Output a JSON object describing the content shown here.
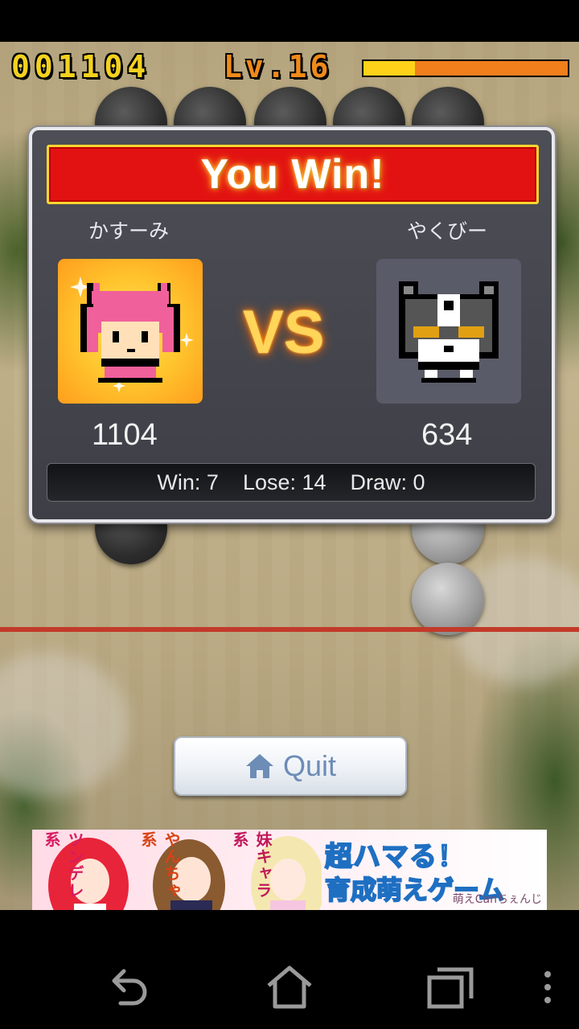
{
  "hud": {
    "score": "001104",
    "level": "Lv.16",
    "level_progress": 0.25,
    "colors": {
      "score": "#f3d21e",
      "level": "#f08a1a"
    }
  },
  "result": {
    "banner": "You Win!",
    "vs": "VS",
    "player": {
      "name": "かすーみ",
      "score": "1104",
      "avatar_icon": "pink-cat-girl-icon"
    },
    "opponent": {
      "name": "やくびー",
      "score": "634",
      "avatar_icon": "gray-cat-robot-icon"
    },
    "stats": {
      "win": "Win: 7",
      "lose": "Lose: 14",
      "draw": "Draw: 0"
    }
  },
  "quit_button": {
    "label": "Quit",
    "icon": "home-icon"
  },
  "ad": {
    "tags": [
      "ツンデレ系",
      "やんちゃ系",
      "妹キャラ系"
    ],
    "headline": "超ハマる！",
    "subline": "育成萌えゲーム",
    "credit": "萌えCanちぇんじ"
  },
  "nav": {
    "icons": [
      "back-icon",
      "home-icon",
      "recent-apps-icon",
      "menu-icon"
    ]
  }
}
